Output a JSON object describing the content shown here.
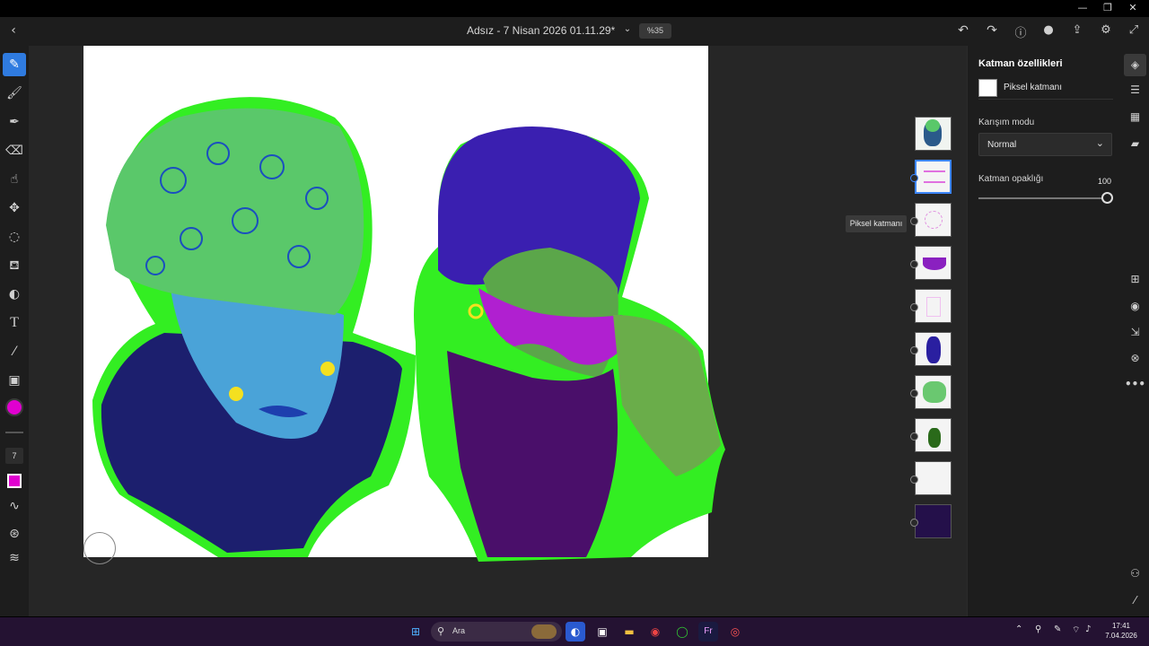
{
  "window": {
    "minimize_icon": "minimize-icon",
    "maximize_icon": "restore-icon",
    "close_icon": "close-icon"
  },
  "appbar": {
    "back_icon": "chevron-left-icon",
    "document_title": "Adsız - 7 Nisan 2026 01.11.29*",
    "title_menu_icon": "chevron-down-icon",
    "zoom": "%35",
    "actions": [
      "undo-icon",
      "redo-icon",
      "help-icon",
      "user-icon",
      "share-icon",
      "settings-icon",
      "fullscreen-icon"
    ]
  },
  "toolbar": {
    "tools": [
      "pixel-brush-icon",
      "live-brush-icon",
      "vector-brush-icon",
      "eraser-icon",
      "smudge-icon",
      "move-icon",
      "lasso-icon",
      "fill-icon",
      "blend-icon",
      "text-icon",
      "eyedropper-icon",
      "image-icon"
    ],
    "color_swatch": "#e000d0",
    "brush_size": "7",
    "secondary_color": "#e000d0"
  },
  "layers_panel": {
    "tooltip": "Piksel katmanı",
    "thumbnails": [
      "layer-1",
      "layer-2",
      "layer-3",
      "layer-4",
      "layer-5",
      "layer-6",
      "layer-7",
      "layer-8",
      "layer-9",
      "layer-10"
    ]
  },
  "properties": {
    "title": "Katman özellikleri",
    "layer_type": "Piksel katmanı",
    "blend_label": "Karışım modu",
    "blend_value": "Normal",
    "opacity_label": "Katman opaklığı",
    "opacity_value": "100"
  },
  "rightbar": {
    "icons": [
      "layers-icon",
      "adjust-icon",
      "grid-icon",
      "comment-icon",
      "add-layer-icon",
      "visibility-icon",
      "import-icon",
      "mask-icon",
      "more-icon",
      "shapes-icon",
      "ruler-icon"
    ]
  },
  "taskbar": {
    "search_placeholder": "Ara",
    "time": "17:41",
    "date": "7.04.2026",
    "accent_colors": {
      "taskbar": "#241232"
    }
  }
}
